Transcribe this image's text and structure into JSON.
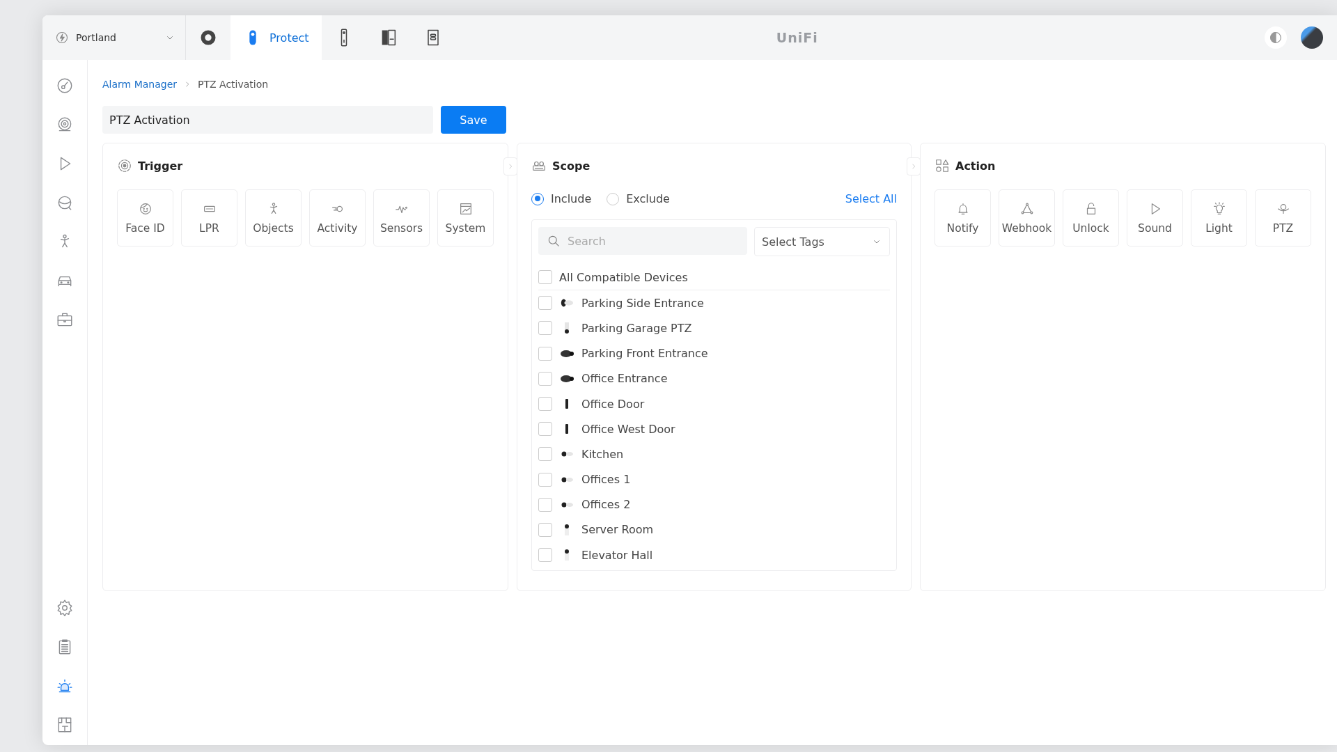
{
  "site_selector": {
    "value": "Portland"
  },
  "app_tabs": [
    {
      "kind": "network",
      "selected": false
    },
    {
      "kind": "protect",
      "label": "Protect",
      "selected": true
    },
    {
      "kind": "doorbell",
      "selected": false
    },
    {
      "kind": "access",
      "selected": false
    },
    {
      "kind": "talk",
      "selected": false
    }
  ],
  "logo": "UniFi",
  "sidebar": {
    "top_items": [
      {
        "kind": "dashboard",
        "selected": false
      },
      {
        "kind": "devices",
        "selected": false
      },
      {
        "kind": "play",
        "selected": false
      },
      {
        "kind": "detections",
        "selected": false
      },
      {
        "kind": "person",
        "selected": false
      },
      {
        "kind": "vehicle",
        "selected": false
      },
      {
        "kind": "toolbox",
        "selected": false
      }
    ],
    "bottom_items": [
      {
        "kind": "settings",
        "selected": false
      },
      {
        "kind": "logs",
        "selected": false
      },
      {
        "kind": "alarm",
        "selected": true
      },
      {
        "kind": "floorplan",
        "selected": false
      }
    ]
  },
  "breadcrumb": [
    "Alarm Manager",
    "PTZ Activation"
  ],
  "name_field": {
    "value": "PTZ Activation"
  },
  "save_button": "Save",
  "trigger": {
    "title": "Trigger",
    "options": [
      {
        "kind": "face",
        "label": "Face ID"
      },
      {
        "kind": "plate",
        "label": "LPR"
      },
      {
        "kind": "person",
        "label": "Objects"
      },
      {
        "kind": "motion",
        "label": "Activity"
      },
      {
        "kind": "pulse",
        "label": "Sensors"
      },
      {
        "kind": "system",
        "label": "System"
      }
    ]
  },
  "scope": {
    "title": "Scope",
    "modes": [
      {
        "label": "Include",
        "selected": true
      },
      {
        "label": "Exclude",
        "selected": false
      }
    ],
    "select_all": "Select All",
    "search": {
      "placeholder": "Search"
    },
    "tags": {
      "placeholder": "Select Tags"
    },
    "all_devices": {
      "label": "All Compatible Devices",
      "checked": false
    },
    "devices": [
      {
        "kind": "bullet",
        "name": "Parking Side Entrance",
        "checked": false
      },
      {
        "kind": "ptz",
        "name": "Parking Garage PTZ",
        "checked": false
      },
      {
        "kind": "turret",
        "name": "Parking Front Entrance",
        "checked": false
      },
      {
        "kind": "turret",
        "name": "Office Entrance",
        "checked": false
      },
      {
        "kind": "doorbell",
        "name": "Office Door",
        "checked": false
      },
      {
        "kind": "doorbell",
        "name": "Office West Door",
        "checked": false
      },
      {
        "kind": "mini",
        "name": "Kitchen",
        "checked": false
      },
      {
        "kind": "mini",
        "name": "Offices 1",
        "checked": false
      },
      {
        "kind": "mini",
        "name": "Offices 2",
        "checked": false
      },
      {
        "kind": "instant",
        "name": "Server Room",
        "checked": false
      },
      {
        "kind": "instant",
        "name": "Elevator Hall",
        "checked": false
      }
    ]
  },
  "action": {
    "title": "Action",
    "options": [
      {
        "kind": "bell",
        "label": "Notify"
      },
      {
        "kind": "webhook",
        "label": "Webhook"
      },
      {
        "kind": "lock",
        "label": "Unlock"
      },
      {
        "kind": "play",
        "label": "Sound"
      },
      {
        "kind": "bulb",
        "label": "Light"
      },
      {
        "kind": "ptz",
        "label": "PTZ"
      }
    ]
  }
}
